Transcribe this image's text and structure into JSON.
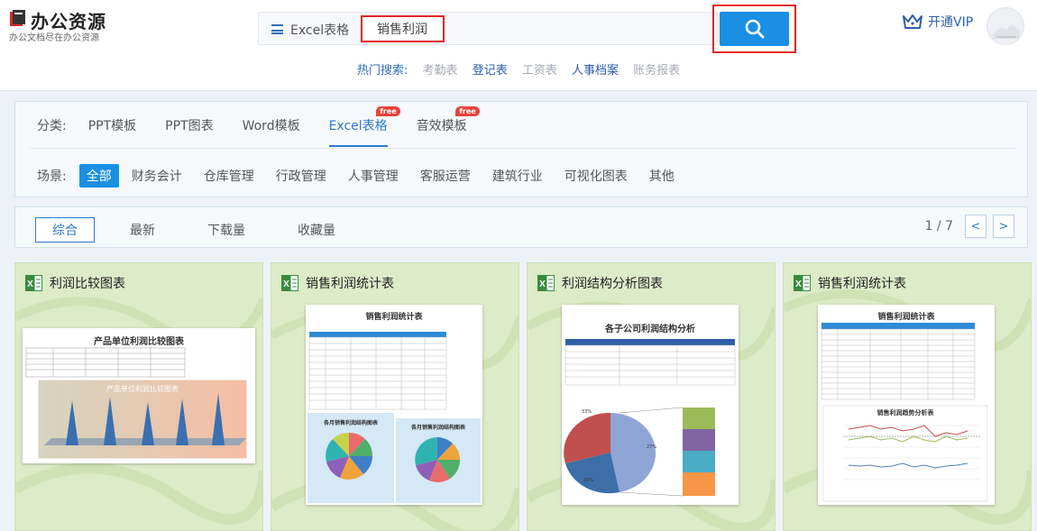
{
  "header": {
    "logo_title": "办公资源",
    "logo_subtitle": "办公文档尽在办公资源",
    "category_toggle": "Excel表格",
    "search_value": "销售利润",
    "vip_label": "开通VIP",
    "hot_label": "热门搜索:",
    "hot_terms": [
      "考勤表",
      "登记表",
      "工资表",
      "人事档案",
      "账务报表"
    ]
  },
  "filter": {
    "category_label": "分类:",
    "categories": [
      "PPT模板",
      "PPT图表",
      "Word模板",
      "Excel表格",
      "音效模板"
    ],
    "active_category": "Excel表格",
    "free_badge": "free",
    "scene_label": "场景:",
    "scenes": [
      "全部",
      "财务会计",
      "仓库管理",
      "行政管理",
      "人事管理",
      "客服运营",
      "建筑行业",
      "可视化图表",
      "其他"
    ],
    "active_scene": "全部"
  },
  "sort": {
    "options": [
      "综合",
      "最新",
      "下载量",
      "收藏量"
    ],
    "active": "综合",
    "page_indicator": "1 / 7",
    "prev_symbol": "<",
    "next_symbol": ">"
  },
  "cards": [
    {
      "title": "利润比较图表",
      "sheet_title": "产品单位利润比较图表",
      "chart_caption": "产品单位利润比较图表"
    },
    {
      "title": "销售利润统计表",
      "sheet_title": "销售利润统计表",
      "pie_caption_1": "各月销售利润结构图表",
      "pie_caption_2": "各月销售利润结构图表"
    },
    {
      "title": "利润结构分析图表",
      "sheet_title": "各子公司利润结构分析",
      "pct_labels": [
        "33%",
        "27%",
        "35%"
      ]
    },
    {
      "title": "销售利润统计表",
      "sheet_title": "销售利润统计表",
      "line_caption": "销售利润趋势分析表"
    }
  ],
  "colors": {
    "accent": "#1a8fe3",
    "highlight_border": "#e0262a",
    "card_bg": "#dcebc8",
    "free_badge": "#e9433a"
  }
}
